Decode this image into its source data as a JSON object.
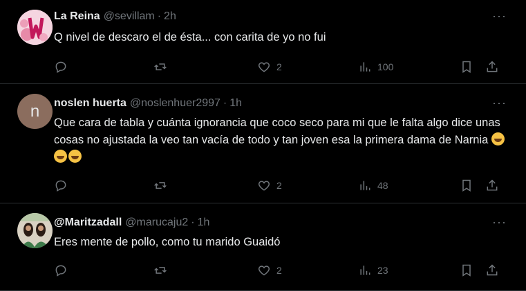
{
  "tweets": [
    {
      "name": "La Reina",
      "handle": "@sevillam",
      "time": "2h",
      "text": "Q nivel de descaro el de ésta... con carita de yo no fui",
      "emojis": [],
      "replies": "",
      "retweets": "",
      "likes": "2",
      "views": "100",
      "avatar": "rose-M-avatar"
    },
    {
      "name": "noslen huerta",
      "handle": "@noslenhuer2997",
      "time": "1h",
      "text": "Que cara de tabla y cuánta ignorancia que coco seco para mi que le falta algo dice unas cosas no ajustada la veo tan vacía de todo y tan joven esa la primera dama de Narnia ",
      "emojis": [
        "rolling-on-floor-laughing",
        "rolling-on-floor-laughing",
        "rolling-on-floor-laughing"
      ],
      "replies": "",
      "retweets": "",
      "likes": "2",
      "views": "48",
      "avatar_letter": "n",
      "avatar_color": "#8b6d5e"
    },
    {
      "name": "@Maritzadall",
      "handle": "@marucaju2",
      "time": "1h",
      "text": "Eres mente de pollo,  como tu marido Guaidó",
      "emojis": [],
      "replies": "",
      "retweets": "",
      "likes": "2",
      "views": "23",
      "avatar": "group-photo-avatar"
    }
  ],
  "separator": "·",
  "more_label": "···",
  "colors": {
    "background": "#000000",
    "text": "#e7e9ea",
    "muted": "#71767b",
    "divider": "#2f3336"
  }
}
